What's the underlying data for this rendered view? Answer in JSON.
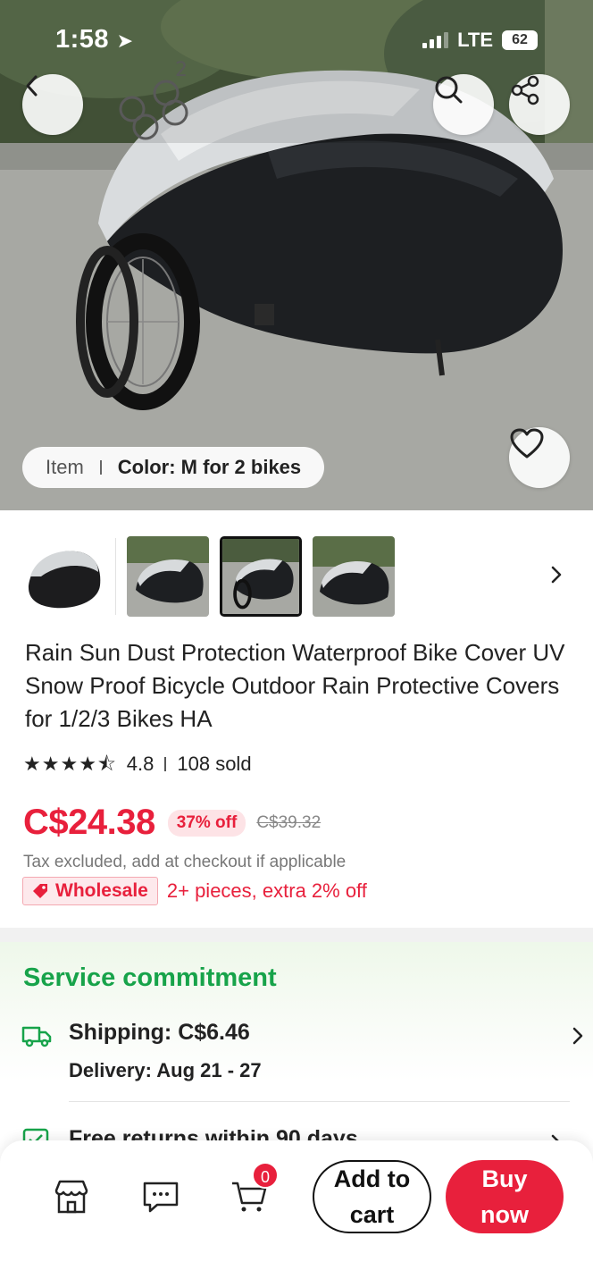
{
  "status_bar": {
    "time": "1:58",
    "network": "LTE",
    "battery": "62"
  },
  "hero": {
    "variant_item_label": "Item",
    "variant_color_label": "Color: M for 2 bikes"
  },
  "product": {
    "title": "Rain Sun Dust Protection Waterproof Bike Cover UV Snow Proof Bicycle Outdoor Rain Protective Covers for 1/2/3 Bikes HA",
    "rating": "4.8",
    "rating_stars": 4.8,
    "sold": "108 sold",
    "price": "C$24.38",
    "discount": "37% off",
    "original_price": "C$39.32",
    "tax_note": "Tax excluded, add at checkout if applicable",
    "wholesale_badge": "Wholesale",
    "wholesale_text": "2+ pieces, extra 2% off"
  },
  "thumbnails": {
    "count": 4,
    "selected_index": 2
  },
  "service": {
    "title": "Service commitment",
    "shipping": "Shipping: C$6.46",
    "delivery": "Delivery: Aug 21 - 27",
    "returns": "Free returns within 90 days"
  },
  "bottom_bar": {
    "cart_count": "0",
    "add_to_cart": "Add to cart",
    "buy_now": "Buy now"
  },
  "colors": {
    "accent": "#e8203c",
    "service_green": "#17a34a"
  }
}
